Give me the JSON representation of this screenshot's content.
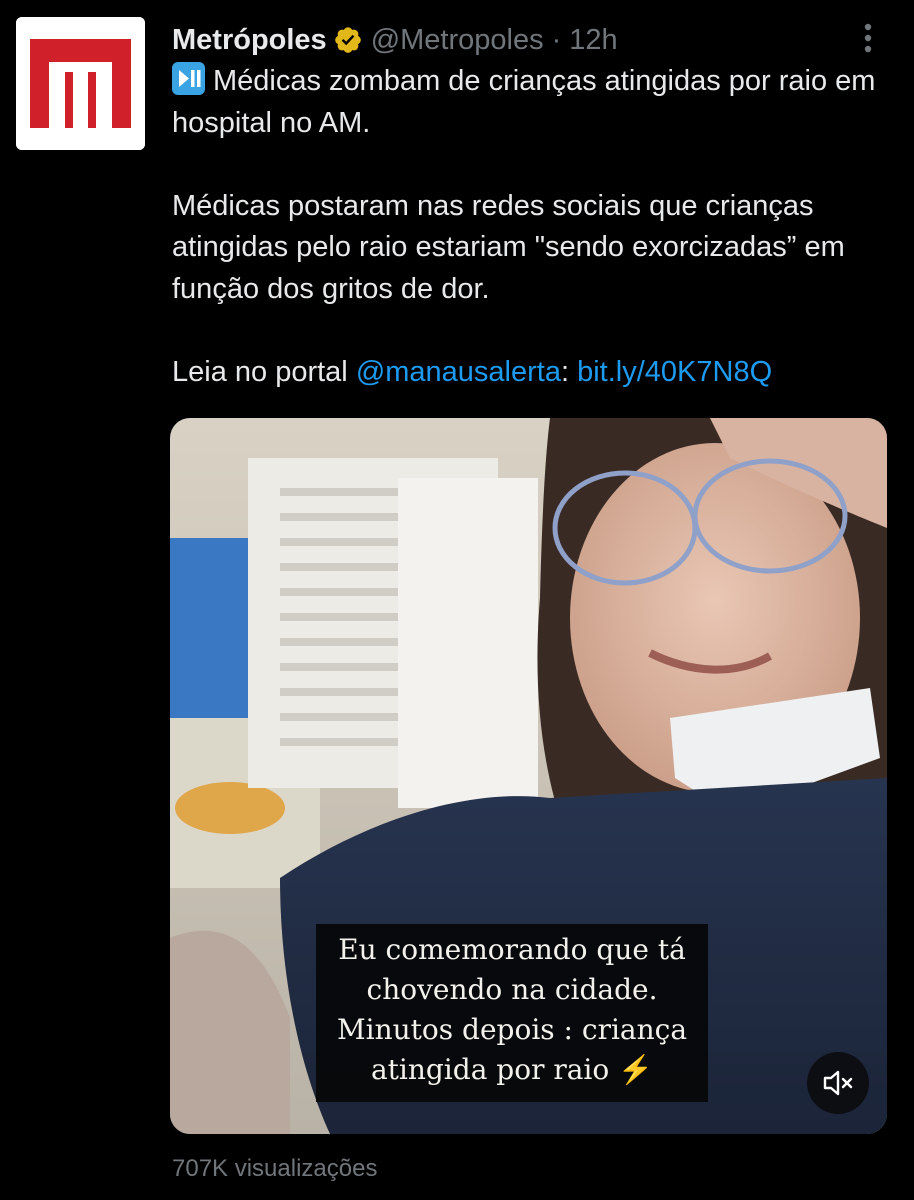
{
  "tweet": {
    "author": {
      "display_name": "Metrópoles",
      "handle": "@Metropoles",
      "avatar_letter": "M",
      "avatar_icon": "metropoles-logo-icon"
    },
    "separator": "·",
    "time": "12h",
    "text": {
      "line1_emoji": "play-pause-icon",
      "line1": "Médicas zombam de crianças atingidas por raio em hospital no AM.",
      "paragraph2": "Médicas postaram nas redes sociais que crianças atingidas pelo raio estariam \"sendo exorcizadas” em função dos gritos de dor.",
      "paragraph3_prefix": "Leia no portal ",
      "mention": "@manausalerta",
      "separator": ": ",
      "url": "bit.ly/40K7N8Q"
    },
    "media": {
      "caption_lines": [
        "Eu comemorando que tá",
        "chovendo na cidade.",
        "Minutos depois : criança",
        "atingida por raio"
      ],
      "caption_emoji": "⚡",
      "mute_icon": "speaker-muted-icon"
    },
    "views": "707K visualizações"
  },
  "colors": {
    "background": "#000000",
    "text": "#e7e9ea",
    "secondary": "#71767b",
    "link": "#1d9bf0",
    "brand_red": "#d0202a",
    "verified_gold": "#e2b719"
  }
}
